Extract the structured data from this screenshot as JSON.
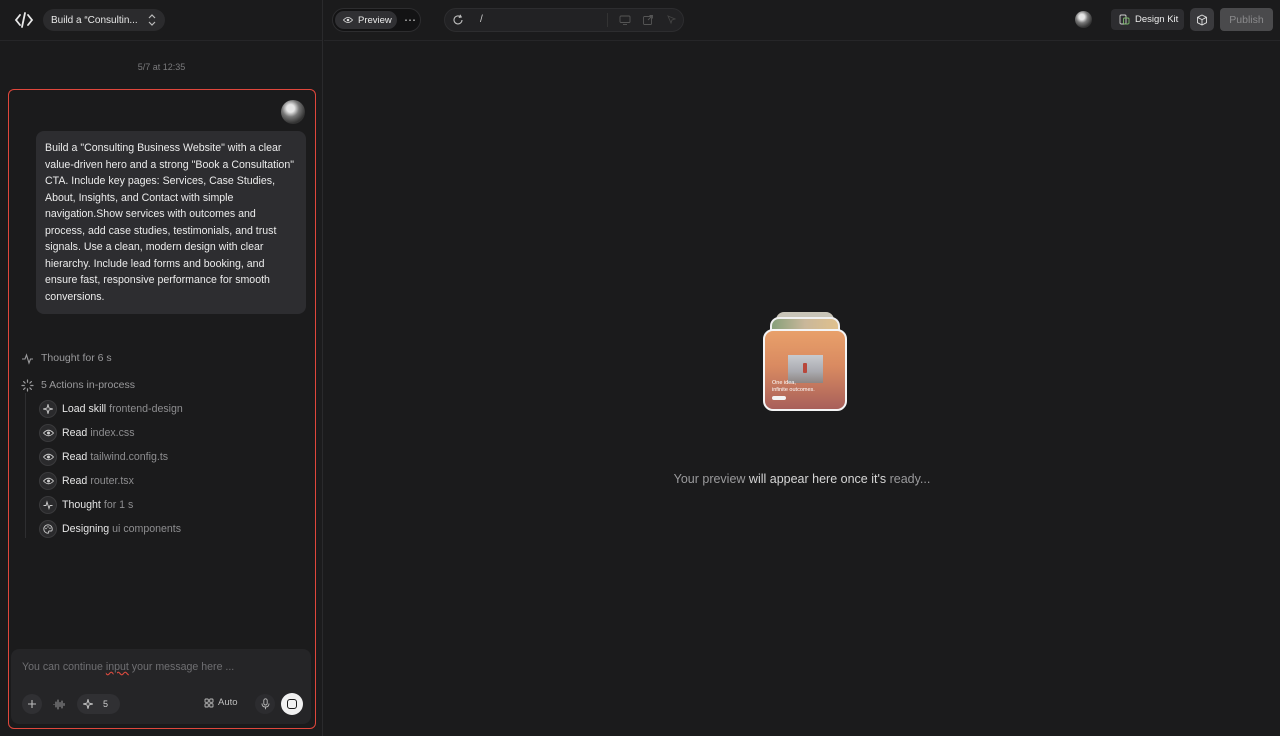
{
  "project": {
    "title": "Build a “Consultin..."
  },
  "chat": {
    "timestamp": "5/7 at 12:35",
    "user_message": "Build a \"Consulting Business Website\" with a clear value-driven hero and a strong \"Book a Consultation\" CTA. Include key pages: Services, Case Studies, About, Insights, and Contact with simple navigation.Show services with outcomes and process, add case studies, testimonials, and trust signals. Use a clean, modern design with clear hierarchy. Include lead forms and booking, and ensure fast, responsive performance for smooth conversions.",
    "thought": "Thought for 6 s",
    "actions_header": "5 Actions in-process",
    "actions": [
      {
        "icon": "sparkle-icon",
        "verb": "Load skill",
        "object": "frontend-design"
      },
      {
        "icon": "eye-icon",
        "verb": "Read",
        "object": "index.css"
      },
      {
        "icon": "eye-icon",
        "verb": "Read",
        "object": "tailwind.config.ts"
      },
      {
        "icon": "eye-icon",
        "verb": "Read",
        "object": "router.tsx"
      },
      {
        "icon": "pulse-icon",
        "verb": "Thought",
        "object": "for 1 s"
      },
      {
        "icon": "palette-icon",
        "verb": "Designing",
        "object": "ui components"
      }
    ]
  },
  "composer": {
    "placeholder_pre": "You can continue ",
    "placeholder_mid": "input",
    "placeholder_post": " your message here ...",
    "skill_count": "5",
    "mode": "Auto"
  },
  "toolbar": {
    "preview_label": "Preview",
    "url_path": "/",
    "design_kit_label": "Design Kit",
    "publish_label": "Publish"
  },
  "preview": {
    "card_caption": "One idea,\ninfinite outcomes.",
    "msg_1": "Your preview ",
    "msg_2": "will appear here once it's",
    "msg_3": " ready..."
  },
  "colors": {
    "accent_border": "#e0473c",
    "background": "#1b1b1c"
  }
}
